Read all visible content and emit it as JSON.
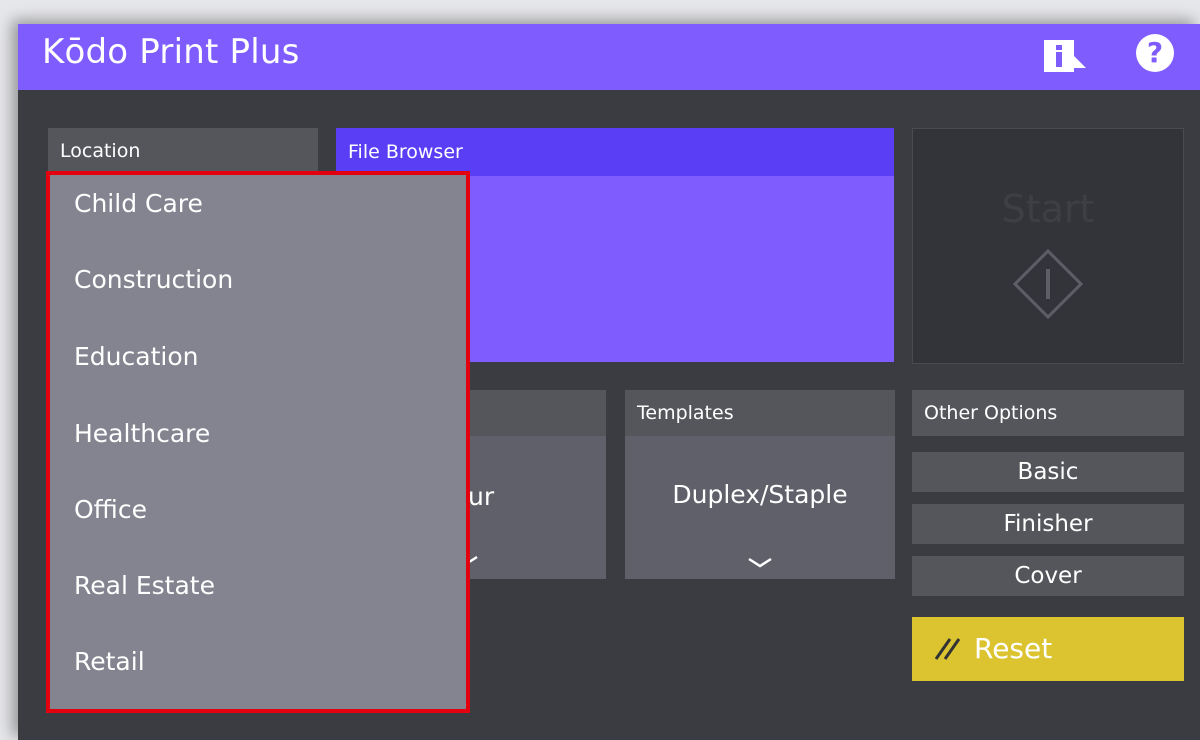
{
  "app": {
    "title": "Kōdo Print Plus"
  },
  "header": {
    "info_icon": "info-icon",
    "help_icon": "help-icon",
    "help_glyph": "?"
  },
  "location": {
    "label": "Location",
    "options": [
      "Child Care",
      "Construction",
      "Education",
      "Healthcare",
      "Office",
      "Real Estate",
      "Retail"
    ]
  },
  "file_browser": {
    "label": "File Browser"
  },
  "start": {
    "label": "Start"
  },
  "color_panel": {
    "value_partial": "ur"
  },
  "templates": {
    "label": "Templates",
    "value": "Duplex/Staple"
  },
  "other_options": {
    "label": "Other Options",
    "buttons": [
      "Basic",
      "Finisher",
      "Cover"
    ]
  },
  "reset": {
    "label": "Reset",
    "icon": "reset-slash-icon"
  },
  "colors": {
    "accent": "#7f5cfe",
    "accent_dark": "#5a3ef5",
    "background": "#3b3c41",
    "reset": "#dcc431",
    "highlight": "#e3000f"
  }
}
